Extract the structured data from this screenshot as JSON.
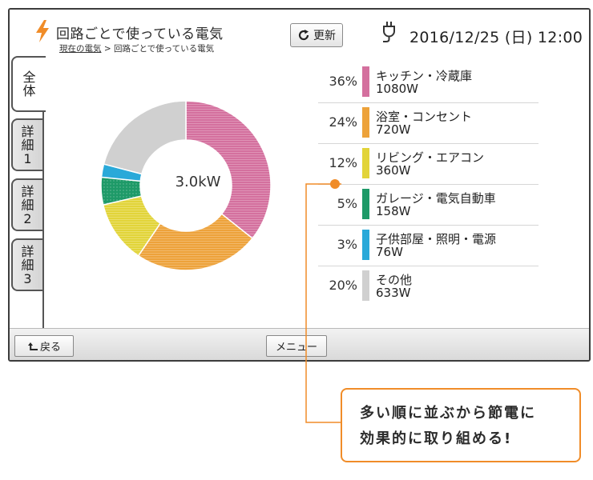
{
  "header": {
    "title": "回路ごとで使っている電気",
    "breadcrumb_link": "現在の電気",
    "breadcrumb_sep": " > ",
    "breadcrumb_current": "回路ごとで使っている電気",
    "refresh_label": "更新",
    "datetime": "2016/12/25 (日) 12:00"
  },
  "tabs": [
    {
      "label_line1": "全",
      "label_line2": "体",
      "label_line3": "",
      "active": true
    },
    {
      "label_line1": "詳",
      "label_line2": "細",
      "label_line3": "1",
      "active": false
    },
    {
      "label_line1": "詳",
      "label_line2": "細",
      "label_line3": "2",
      "active": false
    },
    {
      "label_line1": "詳",
      "label_line2": "細",
      "label_line3": "3",
      "active": false
    }
  ],
  "chart_data": {
    "type": "pie",
    "donut": true,
    "center_label": "3.0kW",
    "categories": [
      "キッチン・冷蔵庫",
      "浴室・コンセント",
      "リビング・エアコン",
      "ガレージ・電気自動車",
      "子供部屋・照明・電源",
      "その他"
    ],
    "values": [
      1080,
      720,
      360,
      158,
      76,
      633
    ],
    "percent_labels": [
      "36%",
      "24%",
      "12%",
      "5%",
      "3%",
      "20%"
    ],
    "watt_labels": [
      "1080W",
      "720W",
      "360W",
      "158W",
      "76W",
      "633W"
    ],
    "colors": [
      "#d4709e",
      "#eda23a",
      "#e2d439",
      "#1e9a68",
      "#2aa9d9",
      "#d0d0d0"
    ]
  },
  "footer": {
    "back_label": "戻る",
    "menu_label": "メニュー"
  },
  "callout": {
    "line1": "多い順に並ぶから節電に",
    "line2": "効果的に取り組める!",
    "accent": "#f08c28"
  }
}
